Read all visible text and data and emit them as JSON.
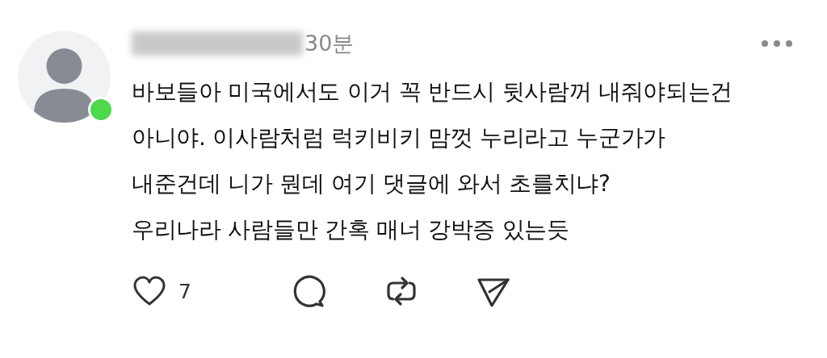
{
  "comment": {
    "time": "30분",
    "author_online": true,
    "lines": [
      "바보들아 미국에서도 이거 꼭 반드시 뒷사람꺼 내줘야되는건",
      "아니야. 이사람처럼 럭키비키 맘껏 누리라고 누군가가",
      "내준건데 니가 뭔데 여기 댓글에 와서 초를치냐?",
      "우리나라 사람들만 간혹 매너 강박증 있는듯"
    ],
    "like_count": "7",
    "liked": false
  }
}
